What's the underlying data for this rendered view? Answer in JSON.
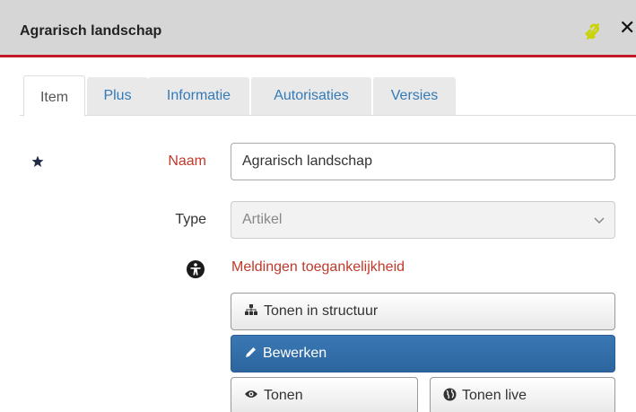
{
  "window": {
    "title": "Agrarisch landschap"
  },
  "tabs": [
    "Item",
    "Plus",
    "Informatie",
    "Autorisaties",
    "Versies"
  ],
  "form": {
    "naam_label": "Naam",
    "naam_value": "Agrarisch landschap",
    "type_label": "Type",
    "type_value": "Artikel"
  },
  "accessibility_link": "Meldingen toegankelijkheid",
  "buttons": {
    "structuur": "Tonen in structuur",
    "bewerken": "Bewerken",
    "tonen": "Tonen",
    "tonen_live": "Tonen live"
  },
  "colors": {
    "accent_red": "#c01a27",
    "primary_blue": "#2f6aa3",
    "link_blue": "#337ab7",
    "unlink_icon": "#c8d400"
  },
  "icons": [
    "unlink-icon",
    "close-icon",
    "star-icon",
    "chevron-down-icon",
    "accessibility-icon",
    "sitemap-icon",
    "pencil-icon",
    "eye-icon",
    "globe-icon"
  ]
}
